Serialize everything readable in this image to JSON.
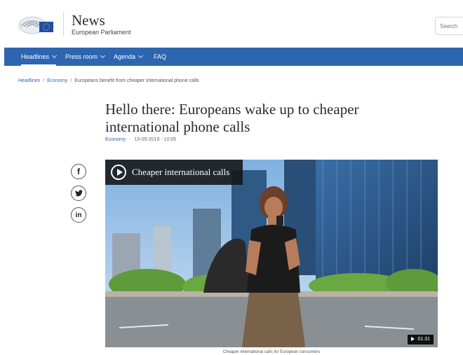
{
  "header": {
    "brand_title": "News",
    "brand_subtitle": "European Parliament",
    "search_placeholder": "Search"
  },
  "nav": {
    "items": [
      {
        "label": "Headlines",
        "has_dropdown": true,
        "active": true
      },
      {
        "label": "Press room",
        "has_dropdown": true,
        "active": false
      },
      {
        "label": "Agenda",
        "has_dropdown": true,
        "active": false
      },
      {
        "label": "FAQ",
        "has_dropdown": false,
        "active": false
      }
    ]
  },
  "breadcrumb": {
    "items": [
      "Headlines",
      "Economy"
    ],
    "current": "Europeans benefit from cheaper international phone calls"
  },
  "article": {
    "title": "Hello there: Europeans wake up to cheaper international phone calls",
    "category": "Economy",
    "datetime": "15-05-2019 - 10:05"
  },
  "social": {
    "icons": [
      "facebook-icon",
      "twitter-icon",
      "linkedin-icon"
    ],
    "facebook_glyph": "f",
    "twitter_glyph": "t",
    "linkedin_glyph": "in"
  },
  "video": {
    "title": "Cheaper international calls",
    "duration": "01:31",
    "caption": "Cheaper international calls for European consumers"
  },
  "colors": {
    "nav_bg": "#2d65b0",
    "link": "#2d65b0"
  }
}
